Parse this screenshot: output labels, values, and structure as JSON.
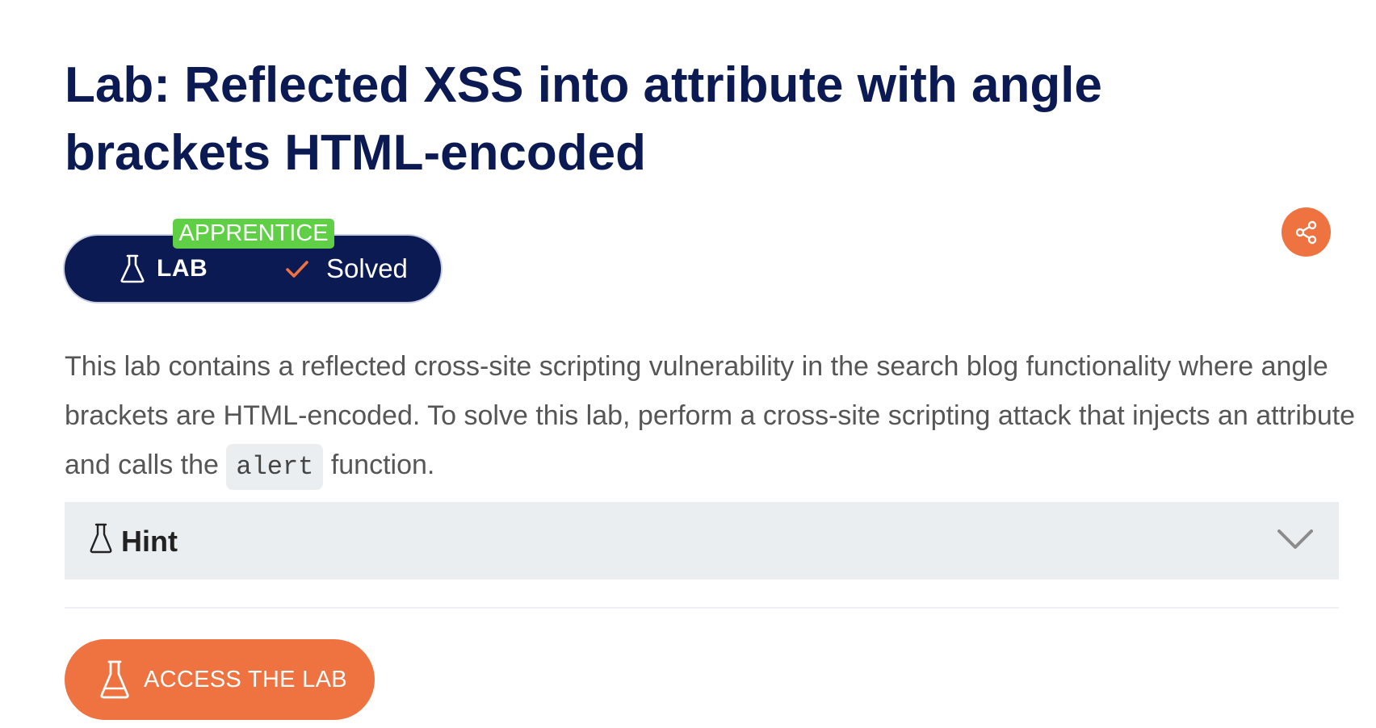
{
  "page": {
    "title": "Lab: Reflected XSS into attribute with angle brackets HTML-encoded"
  },
  "status": {
    "level": "APPRENTICE",
    "type_label": "LAB",
    "state_label": "Solved",
    "icons": [
      "flask-icon",
      "checkmark-icon"
    ]
  },
  "share": {
    "icon": "share-icon"
  },
  "description": {
    "part1": "This lab contains a reflected cross-site scripting vulnerability in the search blog functionality where angle brackets are HTML-encoded. To solve this lab, perform a cross-site scripting attack that injects an attribute and calls the ",
    "code": "alert",
    "part2": " function."
  },
  "hint": {
    "label": "Hint",
    "icons": [
      "flask-icon",
      "chevron-down-icon"
    ]
  },
  "cta": {
    "label": "ACCESS THE LAB",
    "icon": "flask-icon"
  },
  "colors": {
    "navy": "#0b1a52",
    "orange": "#ee7341",
    "green": "#5fcf45",
    "hint_bg": "#ebeef1",
    "text_gray": "#565656"
  }
}
